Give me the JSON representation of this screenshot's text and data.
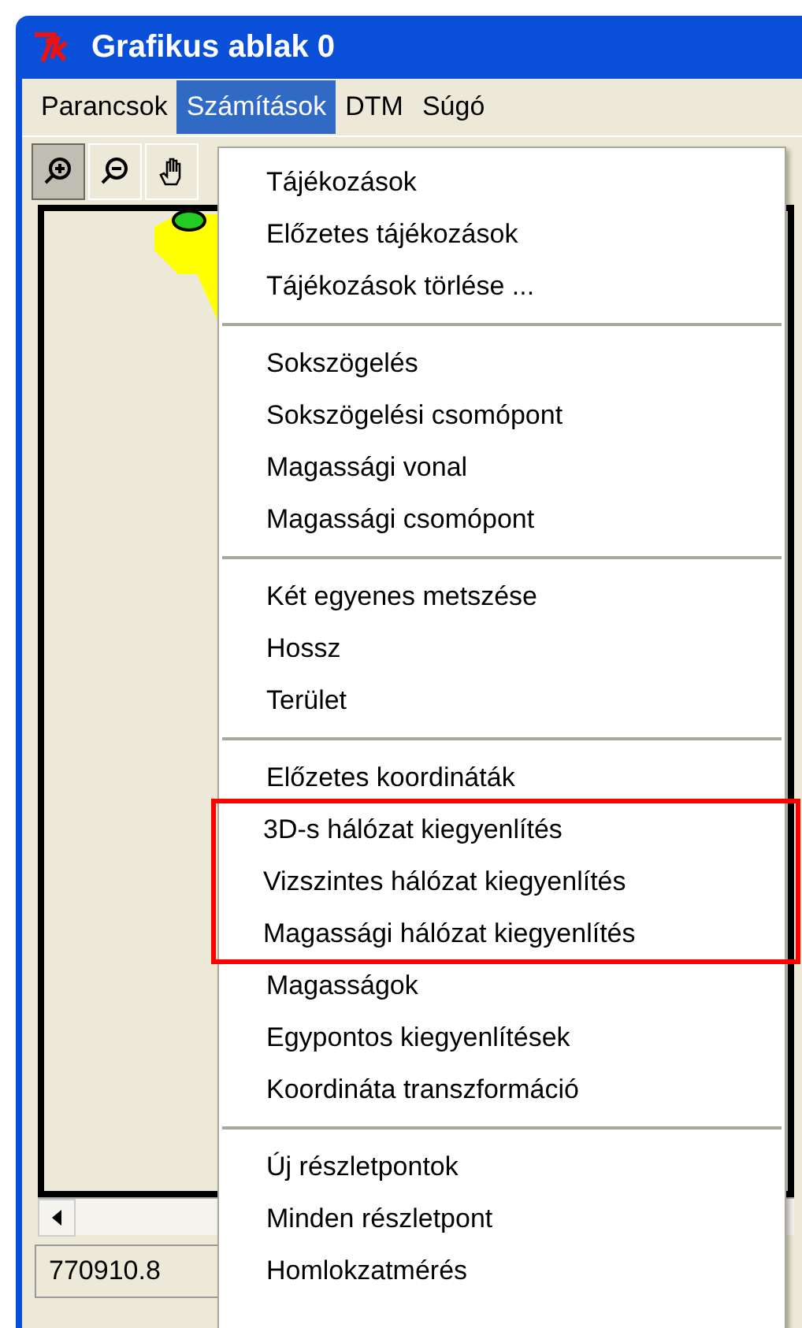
{
  "window": {
    "title": "Grafikus ablak 0"
  },
  "menu_bar": [
    {
      "label": "Parancsok",
      "selected": false
    },
    {
      "label": "Számítások",
      "selected": true
    },
    {
      "label": "DTM",
      "selected": false
    },
    {
      "label": "Súgó",
      "selected": false
    }
  ],
  "toolbar": [
    {
      "kind": "zoom-in",
      "pressed": true
    },
    {
      "kind": "zoom-out",
      "pressed": false
    },
    {
      "kind": "hand",
      "pressed": false
    }
  ],
  "dropdown": {
    "groups": [
      {
        "items": [
          {
            "label": "Tájékozások",
            "highlighted": false
          },
          {
            "label": "Előzetes tájékozások",
            "highlighted": false
          },
          {
            "label": "Tájékozások törlése ...",
            "highlighted": false
          }
        ]
      },
      {
        "items": [
          {
            "label": "Sokszögelés",
            "highlighted": false
          },
          {
            "label": "Sokszögelési csomópont",
            "highlighted": false
          },
          {
            "label": "Magassági vonal",
            "highlighted": false
          },
          {
            "label": "Magassági csomópont",
            "highlighted": false
          }
        ]
      },
      {
        "items": [
          {
            "label": "Két egyenes metszése",
            "highlighted": false
          },
          {
            "label": "Hossz",
            "highlighted": false
          },
          {
            "label": "Terület",
            "highlighted": false
          }
        ]
      },
      {
        "items": [
          {
            "label": "Előzetes koordináták",
            "highlighted": false
          },
          {
            "label": "3D-s hálózat kiegyenlítés",
            "highlighted": true
          },
          {
            "label": "Vizszintes hálózat kiegyenlítés",
            "highlighted": true
          },
          {
            "label": "Magassági hálózat kiegyenlítés",
            "highlighted": true
          },
          {
            "label": "Magasságok",
            "highlighted": false
          },
          {
            "label": "Egypontos kiegyenlítések",
            "highlighted": false
          },
          {
            "label": "Koordináta transzformáció",
            "highlighted": false
          }
        ]
      },
      {
        "items": [
          {
            "label": "Új részletpontok",
            "highlighted": false
          },
          {
            "label": "Minden részletpont",
            "highlighted": false
          },
          {
            "label": "Homlokzatmérés",
            "highlighted": false
          }
        ]
      }
    ]
  },
  "status_bar": {
    "coordinate": "770910.8"
  }
}
